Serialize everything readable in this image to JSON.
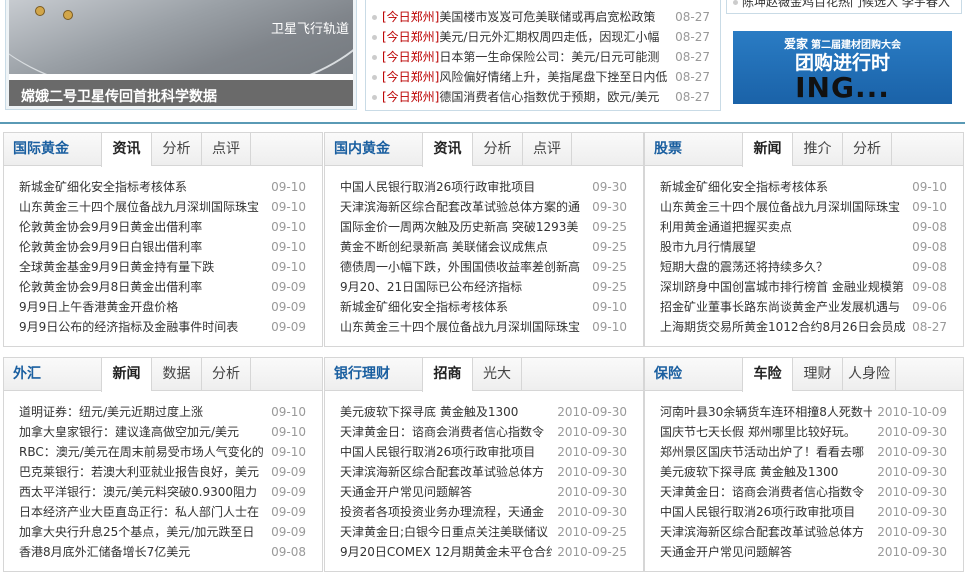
{
  "photo": {
    "orbit_label": "卫星飞行轨道",
    "caption": "嫦娥二号卫星传回首批科学数据"
  },
  "top_news": {
    "prefix": "[今日郑州]",
    "items": [
      {
        "text": "美国楼市岌岌可危美联储或再启宽松政策",
        "date": "08-27"
      },
      {
        "text": "美元/日元外汇期权周四走低，因现汇小幅",
        "date": "08-27"
      },
      {
        "text": "日本第一生命保险公司：美元/日元可能测",
        "date": "08-27"
      },
      {
        "text": "风险偏好情绪上升，美指尾盘下挫至日内低",
        "date": "08-27"
      },
      {
        "text": "德国消费者信心指数优于预期，欧元/美元",
        "date": "08-27"
      }
    ]
  },
  "right_top": {
    "text": "陈坤赵薇金鸡百花热门候选人 李宇春入"
  },
  "ad": {
    "brand": "爱家",
    "subtitle": "第二届建材团购大会",
    "line2": "团购进行时",
    "line3": "ING..."
  },
  "colors": {
    "accent": "#1a5fa0",
    "divider": "#5a9ab5",
    "prefix": "#bb0000",
    "date": "#999999"
  },
  "panels": [
    {
      "title": "国际黄金",
      "tabs": [
        "资讯",
        "分析",
        "点评"
      ],
      "active": 0,
      "items": [
        {
          "text": "新城金矿细化安全指标考核体系",
          "date": "09-10"
        },
        {
          "text": "山东黄金三十四个展位备战九月深圳国际珠宝",
          "date": "09-10"
        },
        {
          "text": "伦敦黄金协会9月9日黄金出借利率",
          "date": "09-10"
        },
        {
          "text": "伦敦黄金协会9月9日白银出借利率",
          "date": "09-10"
        },
        {
          "text": "全球黄金基金9月9日黄金持有量下跌",
          "date": "09-10"
        },
        {
          "text": "伦敦黄金协会9月8日黄金出借利率",
          "date": "09-09"
        },
        {
          "text": "9月9日上午香港黄金开盘价格",
          "date": "09-09"
        },
        {
          "text": "9月9日公布的经济指标及金融事件时间表",
          "date": "09-09"
        }
      ]
    },
    {
      "title": "国内黄金",
      "tabs": [
        "资讯",
        "分析",
        "点评"
      ],
      "active": 0,
      "items": [
        {
          "text": "中国人民银行取消26项行政审批项目",
          "date": "09-30"
        },
        {
          "text": "天津滨海新区综合配套改革试验总体方案的通",
          "date": "09-30"
        },
        {
          "text": "国际金价一周两次触及历史新高 突破1293美",
          "date": "09-25"
        },
        {
          "text": "黄金不断创纪录新高 美联储会议成焦点",
          "date": "09-25"
        },
        {
          "text": "德债周一小幅下跌，外围国债收益率差创新高",
          "date": "09-25"
        },
        {
          "text": "9月20、21日国际已公布经济指标",
          "date": "09-25"
        },
        {
          "text": "新城金矿细化安全指标考核体系",
          "date": "09-10"
        },
        {
          "text": "山东黄金三十四个展位备战九月深圳国际珠宝",
          "date": "09-10"
        }
      ]
    },
    {
      "title": "股票",
      "tabs": [
        "新闻",
        "推介",
        "分析"
      ],
      "active": 0,
      "items": [
        {
          "text": "新城金矿细化安全指标考核体系",
          "date": "09-10"
        },
        {
          "text": "山东黄金三十四个展位备战九月深圳国际珠宝",
          "date": "09-10"
        },
        {
          "text": "利用黄金通道把握买卖点",
          "date": "09-08"
        },
        {
          "text": "股市九月行情展望",
          "date": "09-08"
        },
        {
          "text": "短期大盘的震荡还将持续多久？",
          "date": "09-08"
        },
        {
          "text": "深圳跻身中国创富城市排行榜首 金融业规模第",
          "date": "09-08"
        },
        {
          "text": "招金矿业董事长路东尚谈黄金产业发展机遇与",
          "date": "09-06"
        },
        {
          "text": "上海期货交易所黄金1012合约8月26日会员成",
          "date": "08-27"
        }
      ]
    },
    {
      "title": "外汇",
      "tabs": [
        "新闻",
        "数据",
        "分析"
      ],
      "active": 0,
      "items": [
        {
          "text": "道明证券：纽元/美元近期过度上涨",
          "date": "09-10"
        },
        {
          "text": "加拿大皇家银行：建议逢高做空加元/美元",
          "date": "09-10"
        },
        {
          "text": "RBC：澳元/美元在周末前易受市场人气变化的",
          "date": "09-10"
        },
        {
          "text": "巴克莱银行：若澳大利亚就业报告良好，美元",
          "date": "09-09"
        },
        {
          "text": "西太平洋银行：澳元/美元料突破0.9300阻力",
          "date": "09-09"
        },
        {
          "text": "日本经济产业大臣直岛正行：私人部门人士在",
          "date": "09-09"
        },
        {
          "text": "加拿大央行升息25个基点，美元/加元跌至日",
          "date": "09-09"
        },
        {
          "text": "香港8月底外汇储备增长7亿美元",
          "date": "09-08"
        }
      ]
    },
    {
      "title": "银行理财",
      "tabs": [
        "招商",
        "光大"
      ],
      "active": 0,
      "long": true,
      "items": [
        {
          "text": "美元疲软下探寻底 黄金触及1300",
          "date": "2010-09-30"
        },
        {
          "text": "天津黄金日：谘商会消费者信心指数令",
          "date": "2010-09-30"
        },
        {
          "text": "中国人民银行取消26项行政审批项目",
          "date": "2010-09-30"
        },
        {
          "text": "天津滨海新区综合配套改革试验总体方",
          "date": "2010-09-30"
        },
        {
          "text": "天通金开户常见问题解答",
          "date": "2010-09-30"
        },
        {
          "text": "投资者各项投资业务办理流程，天通金",
          "date": "2010-09-30"
        },
        {
          "text": "天津黄金日;白银今日重点关注美联储议",
          "date": "2010-09-25"
        },
        {
          "text": "9月20日COMEX 12月期黄金未平仓合约",
          "date": "2010-09-25"
        }
      ]
    },
    {
      "title": "保险",
      "tabs": [
        "车险",
        "理财",
        "人身险"
      ],
      "active": 0,
      "long": true,
      "items": [
        {
          "text": "河南叶县30余辆货车连环相撞8人死数十",
          "date": "2010-10-09"
        },
        {
          "text": "国庆节七天长假 郑州哪里比较好玩。",
          "date": "2010-09-30"
        },
        {
          "text": "郑州景区国庆节活动出炉了！看看去哪",
          "date": "2010-09-30"
        },
        {
          "text": "美元疲软下探寻底 黄金触及1300",
          "date": "2010-09-30"
        },
        {
          "text": "天津黄金日：谘商会消费者信心指数令",
          "date": "2010-09-30"
        },
        {
          "text": "中国人民银行取消26项行政审批项目",
          "date": "2010-09-30"
        },
        {
          "text": "天津滨海新区综合配套改革试验总体方",
          "date": "2010-09-30"
        },
        {
          "text": "天通金开户常见问题解答",
          "date": "2010-09-30"
        }
      ]
    }
  ]
}
